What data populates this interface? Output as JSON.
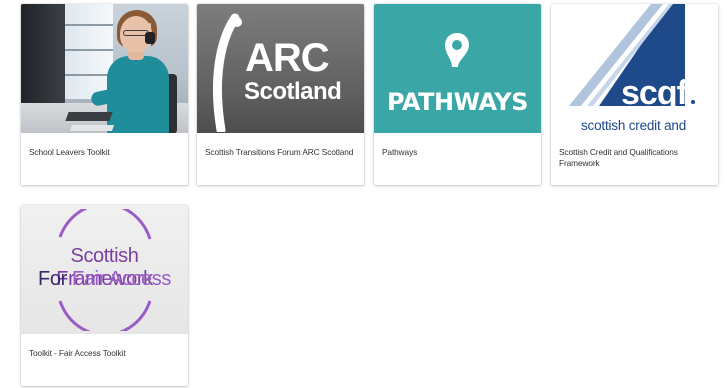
{
  "cards": [
    {
      "caption": "School Leavers Toolkit",
      "image": "photo-woman-at-computer-headset"
    },
    {
      "caption": "Scottish Transitions Forum ARC Scotland",
      "image": "arc-scotland-logo",
      "logo_line1": "ARC",
      "logo_line2": "Scotland"
    },
    {
      "caption": "Pathways",
      "image": "pathways-logo",
      "logo_text": "PATHWAYS"
    },
    {
      "caption": "Scottish Credit and Qualifications Framework",
      "image": "scqf-logo",
      "logo_word": "scqf",
      "logo_sub": "scottish credit and"
    },
    {
      "caption": "Toolkit - Fair Access Toolkit",
      "image": "fair-access-logo",
      "logo_line1": "Scottish Framework",
      "logo_line2_a": "For ",
      "logo_line2_b": "Fair Access"
    }
  ],
  "colors": {
    "pathways_teal": "#3aa6a6",
    "scqf_blue": "#1e4a8a",
    "arc_grey": "#6b6b6b",
    "fair_access_purple": "#7a3fa0"
  }
}
